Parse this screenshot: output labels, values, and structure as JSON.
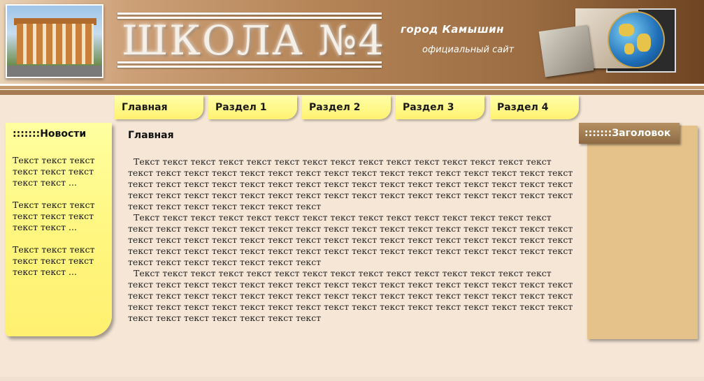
{
  "header": {
    "title": "ШКОЛА №4",
    "city": "город Камышин",
    "site_label": "официальный сайт"
  },
  "nav": {
    "tabs": [
      {
        "label": "Главная"
      },
      {
        "label": "Раздел 1"
      },
      {
        "label": "Раздел 2"
      },
      {
        "label": "Раздел 3"
      },
      {
        "label": "Раздел 4"
      }
    ]
  },
  "news": {
    "title": ":::::::Новости",
    "items": [
      "Текст текст текст текст текст текст текст текст ...",
      "Текст текст текст текст текст текст текст текст ...",
      "Текст текст текст текст текст текст текст текст ..."
    ]
  },
  "main": {
    "heading": "Главная",
    "paragraphs": [
      "Текст текст текст текст текст текст текст текст текст текст текст текст текст текст текст текст текст текст текст текст текст текст текст текст текст текст текст текст текст текст текст текст текст текст текст текст текст текст текст текст текст текст текст текст текст текст текст текст текст текст текст текст текст текст текст текст текст текст текст текст текст текст текст текст текст текст текст текст текст текст",
      "Текст текст текст текст текст текст текст текст текст текст текст текст текст текст текст текст текст текст текст текст текст текст текст текст текст текст текст текст текст текст текст текст текст текст текст текст текст текст текст текст текст текст текст текст текст текст текст текст текст текст текст текст текст текст текст текст текст текст текст текст текст текст текст текст текст текст текст текст текст текст",
      "Текст текст текст текст текст текст текст текст текст текст текст текст текст текст текст текст текст текст текст текст текст текст текст текст текст текст текст текст текст текст текст текст текст текст текст текст текст текст текст текст текст текст текст текст текст текст текст текст текст текст текст текст текст текст текст текст текст текст текст текст текст текст текст текст текст текст текст текст текст текст"
    ]
  },
  "right": {
    "heading": ":::::::Заголовок"
  }
}
